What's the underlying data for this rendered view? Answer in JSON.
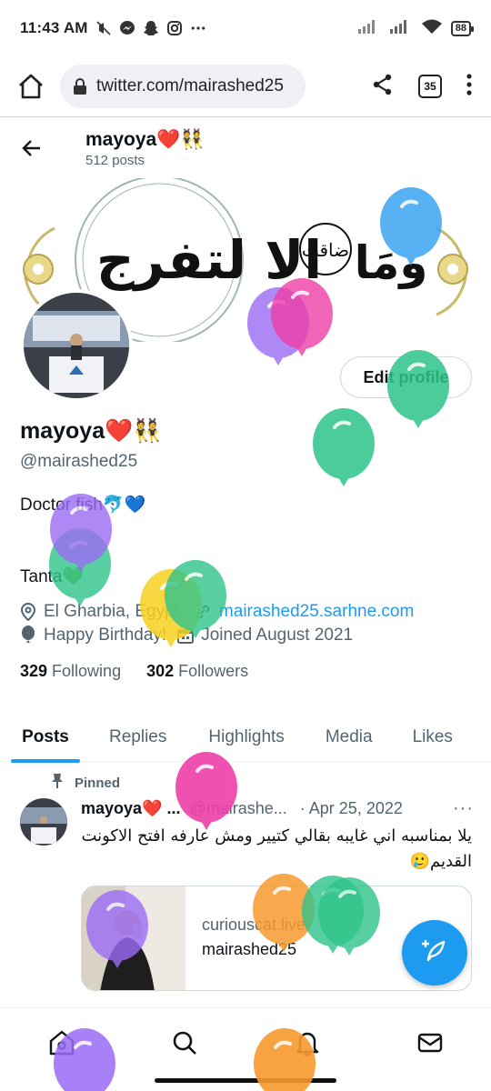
{
  "status_bar": {
    "time": "11:43 AM",
    "battery": "88"
  },
  "browser": {
    "url": "twitter.com/mairashed25",
    "tab_count": "35"
  },
  "header": {
    "name": "mayoya❤️👯",
    "posts": "512 posts"
  },
  "banner": {
    "calligraphy_right": "ومَا",
    "calligraphy_circle": "ضاقت",
    "calligraphy_main": "الا لتفرج"
  },
  "profile": {
    "edit_label": "Edit profile",
    "name": "mayoya❤️👯",
    "handle": "@mairashed25",
    "bio_line1": "Doctor fish🐬💙",
    "bio_line2": "Tanta💚",
    "location": "El Gharbia, Egypt",
    "website": "mairashed25.sarhne.com",
    "birthday": "Happy Birthday!",
    "joined": "Joined August 2021",
    "following_count": "329",
    "following_label": "Following",
    "followers_count": "302",
    "followers_label": "Followers"
  },
  "tabs": [
    {
      "label": "Posts",
      "active": true
    },
    {
      "label": "Replies",
      "active": false
    },
    {
      "label": "Highlights",
      "active": false
    },
    {
      "label": "Media",
      "active": false
    },
    {
      "label": "Likes",
      "active": false
    }
  ],
  "pinned_post": {
    "pinned_label": "Pinned",
    "author": "mayoya❤️ ...",
    "handle": "@mairashe...",
    "date": "· Apr 25, 2022",
    "more": "···",
    "text": "يلا بمناسبه اني غايبه بقالي كتيير ومش عارفه افتح الاكونت القديم🥲",
    "card_domain": "curiouscat.live",
    "card_title": "mairashed25"
  },
  "icons": {
    "home": "home-icon",
    "search": "search-icon",
    "notifications": "bell-icon",
    "messages": "mail-icon",
    "compose": "compose-icon"
  },
  "colors": {
    "accent": "#1d9bf0",
    "text": "#0f1419",
    "muted": "#536471"
  }
}
